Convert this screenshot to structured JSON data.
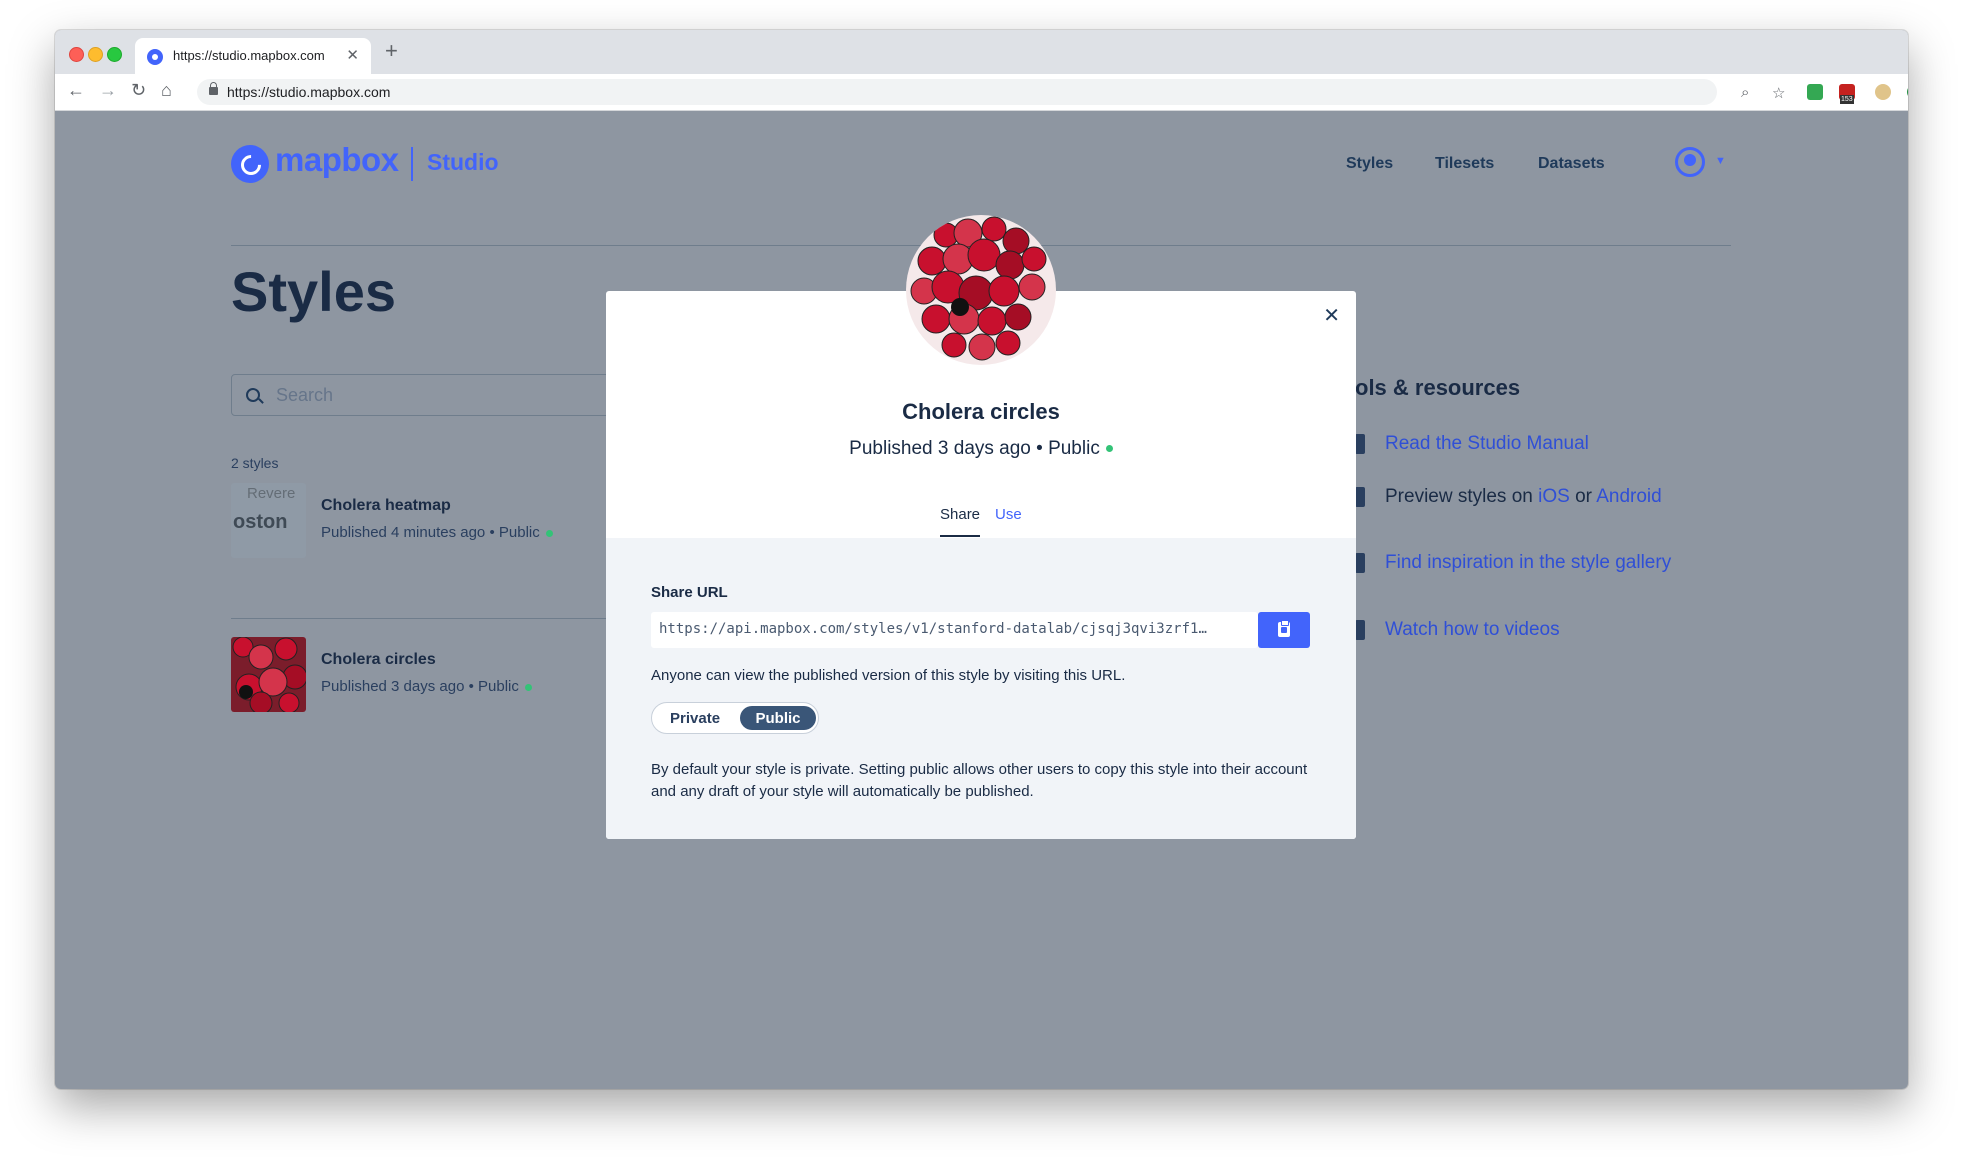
{
  "browser": {
    "tab_title": "https://studio.mapbox.com",
    "url": "https://studio.mapbox.com"
  },
  "header": {
    "logo_text": "mapbox",
    "product": "Studio",
    "nav": [
      "Styles",
      "Tilesets",
      "Datasets"
    ]
  },
  "main": {
    "title": "Styles",
    "search_placeholder": "Search",
    "count": "2 styles",
    "styles": [
      {
        "name": "Cholera heatmap",
        "published": "Published 4 minutes ago",
        "visibility": "Public",
        "thumb_text_1": "Revere",
        "thumb_text_2": "oston"
      },
      {
        "name": "Cholera circles",
        "published": "Published 3 days ago",
        "visibility": "Public"
      }
    ]
  },
  "resources": {
    "title": "ols & resources",
    "links": [
      {
        "text": "Read the Studio Manual"
      },
      {
        "prefix": "Preview styles on ",
        "link1": "iOS",
        "middle": " or ",
        "link2": "Android"
      },
      {
        "text": "Find inspiration in the style gallery"
      },
      {
        "text": "Watch how to videos"
      }
    ]
  },
  "modal": {
    "title": "Cholera circles",
    "subtitle": "Published 3 days ago • Public",
    "tabs": {
      "share": "Share",
      "use": "Use"
    },
    "share_label": "Share URL",
    "share_url": "https://api.mapbox.com/styles/v1/stanford-datalab/cjsqj3qvi3zrf1…",
    "help_text_1": "Anyone can view the published version of this style by visiting this URL.",
    "toggle": {
      "private": "Private",
      "public": "Public",
      "selected": "Public"
    },
    "help_text_2": "By default your style is private. Setting public allows other users to copy this style into their account and any draft of your style will automatically be published."
  },
  "colors": {
    "accent": "#4264fb",
    "overlay": "#8e96a1",
    "status_green": "#33c377",
    "circle_red": "#c8102e"
  },
  "icons": [
    "back-icon",
    "forward-icon",
    "reload-icon",
    "home-icon",
    "lock-icon",
    "zoom-icon",
    "star-icon",
    "search-icon",
    "close-icon",
    "clipboard-icon",
    "user-avatar-icon",
    "chevron-down-icon"
  ]
}
